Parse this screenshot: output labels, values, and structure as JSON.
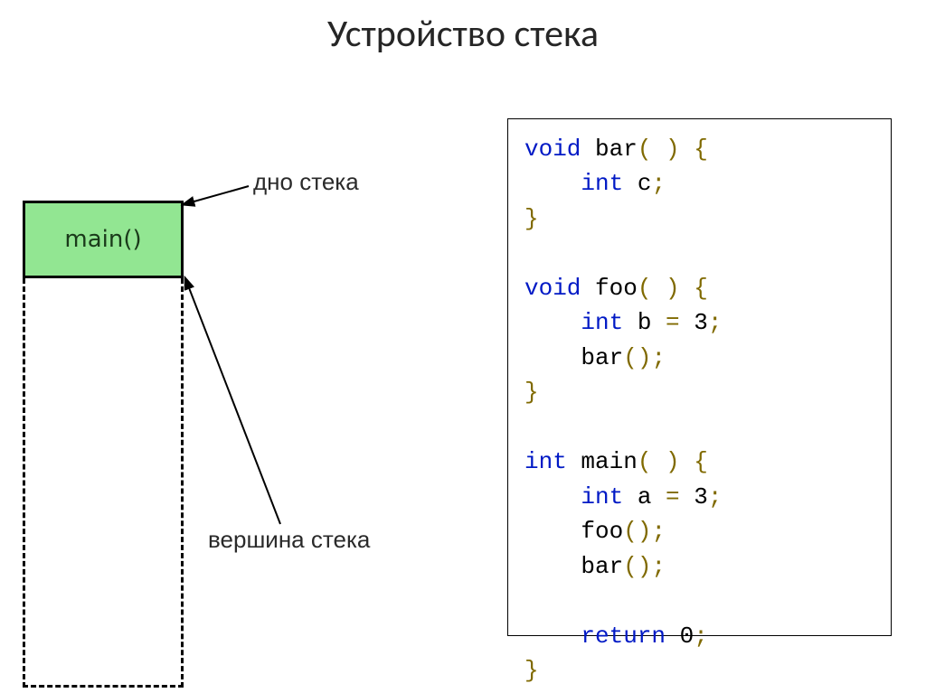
{
  "title": "Устройство стека",
  "stack": {
    "frame_label": "main()",
    "top_label": "дно стека",
    "bottom_label": "вершина стека"
  },
  "code": {
    "l1_kw": "void",
    "l1_nm": " bar",
    "l1_p1": "( )",
    "l1_p2": " {",
    "l2_kw": "int",
    "l2_nm": " c",
    "l2_p": ";",
    "l3_p": "}",
    "l4_kw": "void",
    "l4_nm": " foo",
    "l4_p1": "( )",
    "l4_p2": " {",
    "l5_kw": "int",
    "l5_nm": " b ",
    "l5_eq": "=",
    "l5_num": " 3",
    "l5_p": ";",
    "l6_nm": "bar",
    "l6_p": "();",
    "l7_p": "}",
    "l8_kw": "int",
    "l8_nm": " main",
    "l8_p1": "( )",
    "l8_p2": " {",
    "l9_kw": "int",
    "l9_nm": " a ",
    "l9_eq": "=",
    "l9_num": " 3",
    "l9_p": ";",
    "l10_nm": "foo",
    "l10_p": "();",
    "l11_nm": "bar",
    "l11_p": "();",
    "l12_kw": "return",
    "l12_num": " 0",
    "l12_p": ";",
    "l13_p": "}"
  }
}
